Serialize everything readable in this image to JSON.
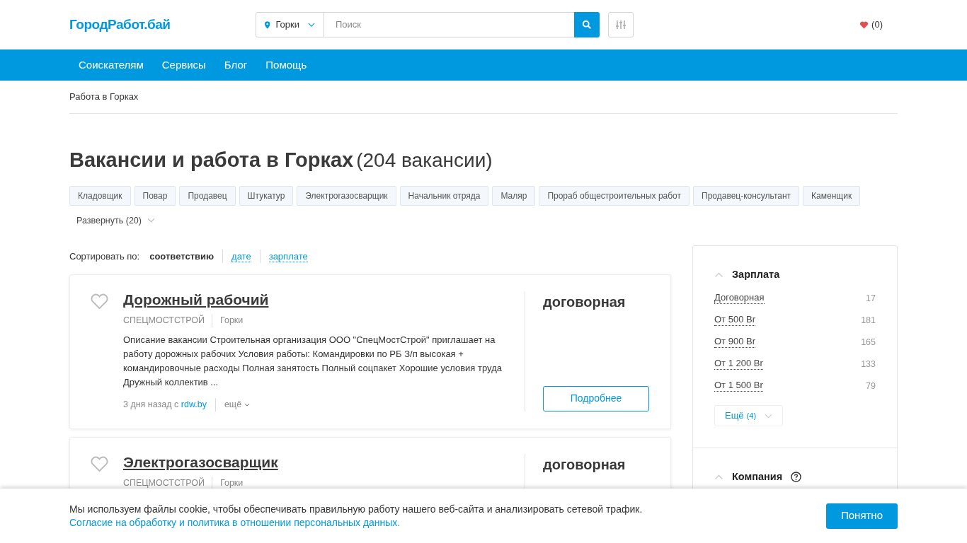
{
  "header": {
    "logo": "ГородРабот.бай",
    "location": "Горки",
    "search": {
      "placeholder": "Поиск"
    },
    "favorites": "(0)"
  },
  "nav": [
    "Соискателям",
    "Сервисы",
    "Блог",
    "Помощь"
  ],
  "breadcrumb": "Работа в Горках",
  "heading": {
    "title": "Вакансии и работа в Горках",
    "count": "(204 вакансии)"
  },
  "tags": [
    "Кладовщик",
    "Повар",
    "Продавец",
    "Штукатур",
    "Электрогазосварщик",
    "Начальник отряда",
    "Маляр",
    "Прораб общестроительных работ",
    "Продавец-консультант",
    "Каменщик"
  ],
  "expand": "Развернуть (20)",
  "sort": {
    "label": "Сортировать по:",
    "options": [
      {
        "label": "соответствию",
        "selected": true
      },
      {
        "label": "дате",
        "selected": false
      },
      {
        "label": "зарплате",
        "selected": false
      }
    ]
  },
  "vacancies": [
    {
      "title": "Дорожный рабочий",
      "company": "СПЕЦМОСТСТРОЙ",
      "city": "Горки",
      "description": "Описание вакансии Строительная организация ООО \"СпецМостСтрой\" приглашает на работу дорожных рабочих Условия работы: Командировки по РБ З/п высокая + командировочные расходы Полная занятость Полный соцпакет Хорошие условия труда Дружный коллектив ...",
      "posted": "3 дня назад с",
      "source": "rdw.by",
      "more": "ещё",
      "salary": "договорная",
      "button": "Подробнее"
    },
    {
      "title": "Электрогазосварщик",
      "company": "СПЕЦМОСТСТРОЙ",
      "city": "Горки",
      "salary": "договорная"
    }
  ],
  "filters": [
    {
      "title": "Зарплата",
      "help": false,
      "items": [
        {
          "label": "Договорная",
          "count": "17"
        },
        {
          "label": "От 500 Br",
          "count": "181"
        },
        {
          "label": "От 900 Br",
          "count": "165"
        },
        {
          "label": "От 1 200 Br",
          "count": "133"
        },
        {
          "label": "От 1 500 Br",
          "count": "79"
        }
      ],
      "more": {
        "label": "Ещё",
        "count": "(4)"
      }
    },
    {
      "title": "Компания",
      "help": true
    }
  ],
  "cookie": {
    "text": "Мы используем файлы cookie, чтобы обеспечивать правильную работу нашего веб-сайта и анализировать сетевой трафик.",
    "link": "Согласие на обработку и политика в отношении персональных данных.",
    "button": "Понятно"
  }
}
